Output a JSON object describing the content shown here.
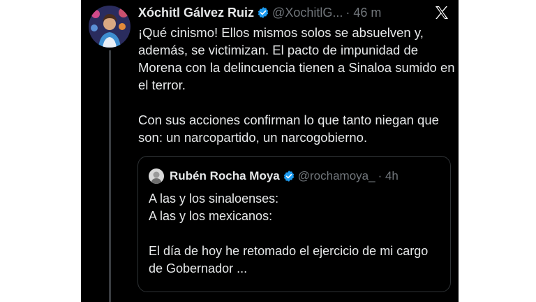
{
  "tweet": {
    "author_name": "Xóchitl Gálvez Ruiz",
    "handle": "@XochitlG...",
    "time": "· 46 m",
    "paragraphs": [
      "¡Qué cinismo! Ellos mismos solos se absuelven y, además, se victimizan. El pacto de impunidad de Morena con la delincuencia tienen a Sinaloa sumido en el terror.",
      "Con sus acciones confirman lo que tanto niegan que son: un narcopartido, un narcogobierno."
    ]
  },
  "quoted_tweet": {
    "author_name": "Rubén Rocha Moya",
    "handle": "@rochamoya_",
    "time": "· 4h",
    "lines": [
      "A las y los sinaloenses:",
      "A las y los mexicanos:"
    ],
    "paragraph": "El día de hoy he retomado el ejercicio de mi cargo de Gobernador ..."
  },
  "icons": {
    "verified": "verified-badge-icon",
    "x_logo": "x-logo-icon"
  },
  "colors": {
    "background": "#000000",
    "text": "#e7e9ea",
    "secondary_text": "#71767b",
    "verified_blue": "#1d9bf0"
  }
}
